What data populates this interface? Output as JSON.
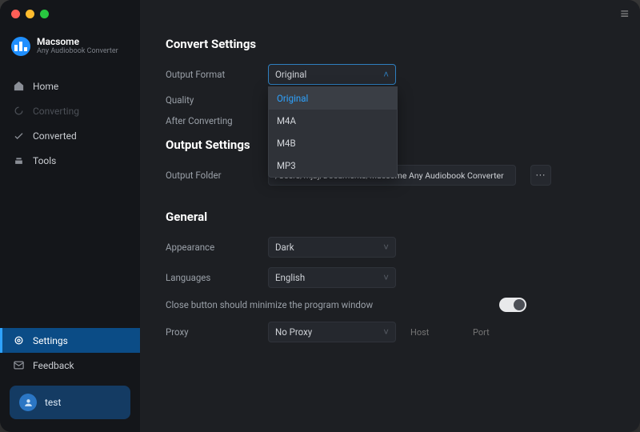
{
  "brand": {
    "name": "Macsome",
    "subtitle": "Any Audiobook Converter"
  },
  "sidebar": {
    "items": [
      {
        "label": "Home"
      },
      {
        "label": "Converting"
      },
      {
        "label": "Converted"
      },
      {
        "label": "Tools"
      },
      {
        "label": "Settings"
      },
      {
        "label": "Feedback"
      }
    ],
    "user": "test"
  },
  "sections": {
    "convert": {
      "title": "Convert Settings",
      "output_format_label": "Output Format",
      "output_format_value": "Original",
      "format_options": [
        "Original",
        "M4A",
        "M4B",
        "MP3"
      ],
      "quality_label": "Quality",
      "after_converting_label": "After Converting"
    },
    "output": {
      "title": "Output Settings",
      "folder_label": "Output Folder",
      "folder_value": "/Users/mjbj/Documents/Macsome Any Audiobook Converter"
    },
    "general": {
      "title": "General",
      "appearance_label": "Appearance",
      "appearance_value": "Dark",
      "languages_label": "Languages",
      "languages_value": "English",
      "minimize_label": "Close button should minimize the program window",
      "proxy_label": "Proxy",
      "proxy_value": "No Proxy",
      "host_placeholder": "Host",
      "port_placeholder": "Port"
    }
  }
}
